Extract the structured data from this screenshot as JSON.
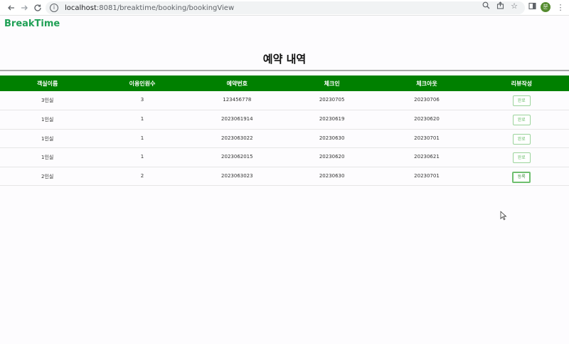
{
  "browser": {
    "back_icon": "arrow-left-icon",
    "forward_icon": "arrow-right-icon",
    "reload_icon": "reload-icon",
    "url_host": "localhost",
    "url_rest": ":8081/breaktime/booking/bookingView",
    "avatar_letter": "분"
  },
  "header": {
    "logo": "BreakTime",
    "logo_color": "#1fa055"
  },
  "page": {
    "title": "예약 내역"
  },
  "table": {
    "header_color": "#008000",
    "columns": [
      "객실이름",
      "이용인원수",
      "예약번호",
      "체크인",
      "체크아웃",
      "리뷰작성"
    ],
    "rows": [
      {
        "room": "3인실",
        "guests": "3",
        "booking_no": "123456778",
        "checkin": "20230705",
        "checkout": "20230706",
        "review": "완료"
      },
      {
        "room": "1인실",
        "guests": "1",
        "booking_no": "2023061914",
        "checkin": "20230619",
        "checkout": "20230620",
        "review": "완료"
      },
      {
        "room": "1인실",
        "guests": "1",
        "booking_no": "2023063022",
        "checkin": "20230630",
        "checkout": "20230701",
        "review": "완료"
      },
      {
        "room": "1인실",
        "guests": "1",
        "booking_no": "2023062015",
        "checkin": "20230620",
        "checkout": "20230621",
        "review": "완료"
      },
      {
        "room": "2인실",
        "guests": "2",
        "booking_no": "2023063023",
        "checkin": "20230630",
        "checkout": "20230701",
        "review": "등록"
      }
    ]
  }
}
